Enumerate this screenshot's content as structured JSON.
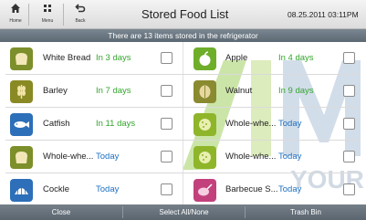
{
  "nav": {
    "home_label": "Home",
    "menu_label": "Menu",
    "back_label": "Back"
  },
  "header": {
    "title": "Stored Food List",
    "datetime": "08.25.2011 03:11PM"
  },
  "info": {
    "message": "There are 13 items stored in the refrigerator"
  },
  "items": [
    {
      "name": "White Bread",
      "days": "In 3 days",
      "status_color": "green",
      "icon": "bread-icon",
      "icon_color": "#7c8f2a",
      "checked": false
    },
    {
      "name": "Apple",
      "days": "In 4 days",
      "status_color": "green",
      "icon": "apple-icon",
      "icon_color": "#6fae2a",
      "checked": false
    },
    {
      "name": "Barley",
      "days": "In 7 days",
      "status_color": "green",
      "icon": "grain-icon",
      "icon_color": "#8a8a24",
      "checked": false
    },
    {
      "name": "Walnut",
      "days": "In 9 days",
      "status_color": "green",
      "icon": "walnut-icon",
      "icon_color": "#8a8a30",
      "checked": false
    },
    {
      "name": "Catfish",
      "days": "In 11 days",
      "status_color": "green",
      "icon": "fish-icon",
      "icon_color": "#2d6fb8",
      "checked": false
    },
    {
      "name": "Whole-whe...",
      "days": "Today",
      "status_color": "blue",
      "icon": "grain-icon",
      "icon_color": "#8fb52a",
      "checked": false
    },
    {
      "name": "Whole-whe...",
      "days": "Today",
      "status_color": "blue",
      "icon": "bread-icon",
      "icon_color": "#7c8f2a",
      "checked": false
    },
    {
      "name": "Whole-whe...",
      "days": "Today",
      "status_color": "blue",
      "icon": "grain-icon",
      "icon_color": "#8fb52a",
      "checked": false
    },
    {
      "name": "Cockle",
      "days": "Today",
      "status_color": "blue",
      "icon": "shell-icon",
      "icon_color": "#2d6fb8",
      "checked": false
    },
    {
      "name": "Barbecue S...",
      "days": "Today",
      "status_color": "blue",
      "icon": "meat-icon",
      "icon_color": "#c2417c",
      "checked": false
    }
  ],
  "watermark": {
    "text_primary": "AIM",
    "text_secondary": "YOUR"
  },
  "footer": {
    "close_label": "Close",
    "select_label": "Select All/None",
    "trash_label": "Trash Bin"
  },
  "colors": {
    "status_green": "#33a52c",
    "status_blue": "#1d6fc0",
    "info_bar": "#66727c",
    "bottom_bar": "#66707a"
  }
}
